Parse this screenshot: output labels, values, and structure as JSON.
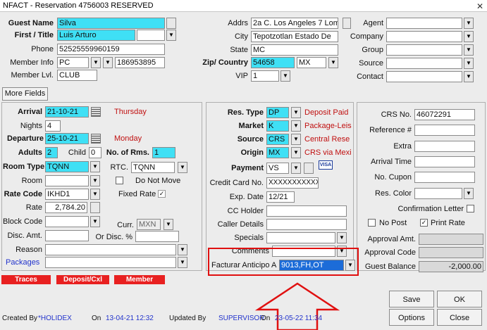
{
  "window": {
    "title": "NFACT - Reservation 4756003  RESERVED",
    "close": "✕"
  },
  "guest": {
    "name_label": "Guest Name",
    "name": "Silva",
    "first_label": "First / Title",
    "first": "Luis Arturo",
    "phone_label": "Phone",
    "phone": "52525559960159",
    "member_info_label": "Member Info",
    "member_type": "PC",
    "member_no": "186953895",
    "member_lvl_label": "Member Lvl.",
    "member_lvl": "CLUB"
  },
  "address": {
    "addrs_label": "Addrs",
    "addrs": "2a C. Los Angeles 7 Lom",
    "city_label": "City",
    "city": "Tepotzotlan Estado De",
    "state_label": "State",
    "state": "MC",
    "zip_label": "Zip/ Country",
    "zip": "54658",
    "country": "MX",
    "vip_label": "VIP",
    "vip": "1"
  },
  "profile": {
    "agent_label": "Agent",
    "company_label": "Company",
    "group_label": "Group",
    "source_label": "Source",
    "contact_label": "Contact"
  },
  "more_fields": "More Fields",
  "stay": {
    "arrival_label": "Arrival",
    "arrival": "21-10-21",
    "arrival_day": "Thursday",
    "nights_label": "Nights",
    "nights": "4",
    "departure_label": "Departure",
    "departure": "25-10-21",
    "departure_day": "Monday",
    "adults_label": "Adults",
    "adults": "2",
    "child_label": "Child",
    "child": "0",
    "rooms_label": "No. of Rms.",
    "rooms": "1",
    "room_type_label": "Room Type",
    "room_type": "TQNN",
    "rtc_label": "RTC.",
    "rtc": "TQNN",
    "room_label": "Room",
    "do_not_move": "Do Not Move",
    "rate_code_label": "Rate Code",
    "rate_code": "IKHD1",
    "fixed_rate": "Fixed Rate",
    "rate_label": "Rate",
    "rate": "2,784.20",
    "block_code_label": "Block Code",
    "curr_label": "Curr.",
    "curr": "MXN",
    "disc_amt_label": "Disc. Amt.",
    "or_disc_label": "Or Disc. %",
    "reason_label": "Reason",
    "packages_label": "Packages"
  },
  "reservation": {
    "res_type_label": "Res. Type",
    "res_type": "DP",
    "res_type_desc": "Deposit Paid",
    "market_label": "Market",
    "market": "K",
    "market_desc": "Package-Leis",
    "source_label": "Source",
    "source": "CRS",
    "source_desc": "Central Rese",
    "origin_label": "Origin",
    "origin": "MX",
    "origin_desc": "CRS via Mexi",
    "payment_label": "Payment",
    "payment": "VS",
    "card_brand": "VISA",
    "cc_no_label": "Credit Card No.",
    "cc_no": "XXXXXXXXXXXX",
    "exp_label": "Exp. Date",
    "exp": "12/21",
    "cc_holder_label": "CC Holder",
    "caller_label": "Caller Details",
    "specials_label": "Specials",
    "comments_label": "Comments",
    "facturar_label": "Facturar Anticipo A",
    "facturar": "9013,FH,OT"
  },
  "crs": {
    "crs_no_label": "CRS No.",
    "crs_no": "46072291",
    "reference_label": "Reference #",
    "extra_label": "Extra",
    "arrival_time_label": "Arrival Time",
    "cupon_label": "No. Cupon",
    "res_color_label": "Res. Color",
    "confirmation_label": "Confirmation Letter",
    "no_post_label": "No Post",
    "print_rate_label": "Print Rate",
    "approval_amt_label": "Approval Amt.",
    "approval_code_label": "Approval Code",
    "guest_balance_label": "Guest Balance",
    "guest_balance": "-2,000.00"
  },
  "tabs": [
    "Traces",
    "Deposit/Cxl",
    "Member"
  ],
  "footer": {
    "created_by_label": "Created By",
    "created_by": "*HOLIDEX",
    "on_label1": "On",
    "created_on": "13-04-21 12:32",
    "updated_by_label": "Updated By",
    "updated_by": "SUPERVISOR",
    "on_label2": "On",
    "updated_on": "23-05-22 11:34"
  },
  "buttons": {
    "save": "Save",
    "ok": "OK",
    "options": "Options",
    "close": "Close"
  },
  "dropdown_glyph": "▼",
  "highlight_color": "#e01010"
}
